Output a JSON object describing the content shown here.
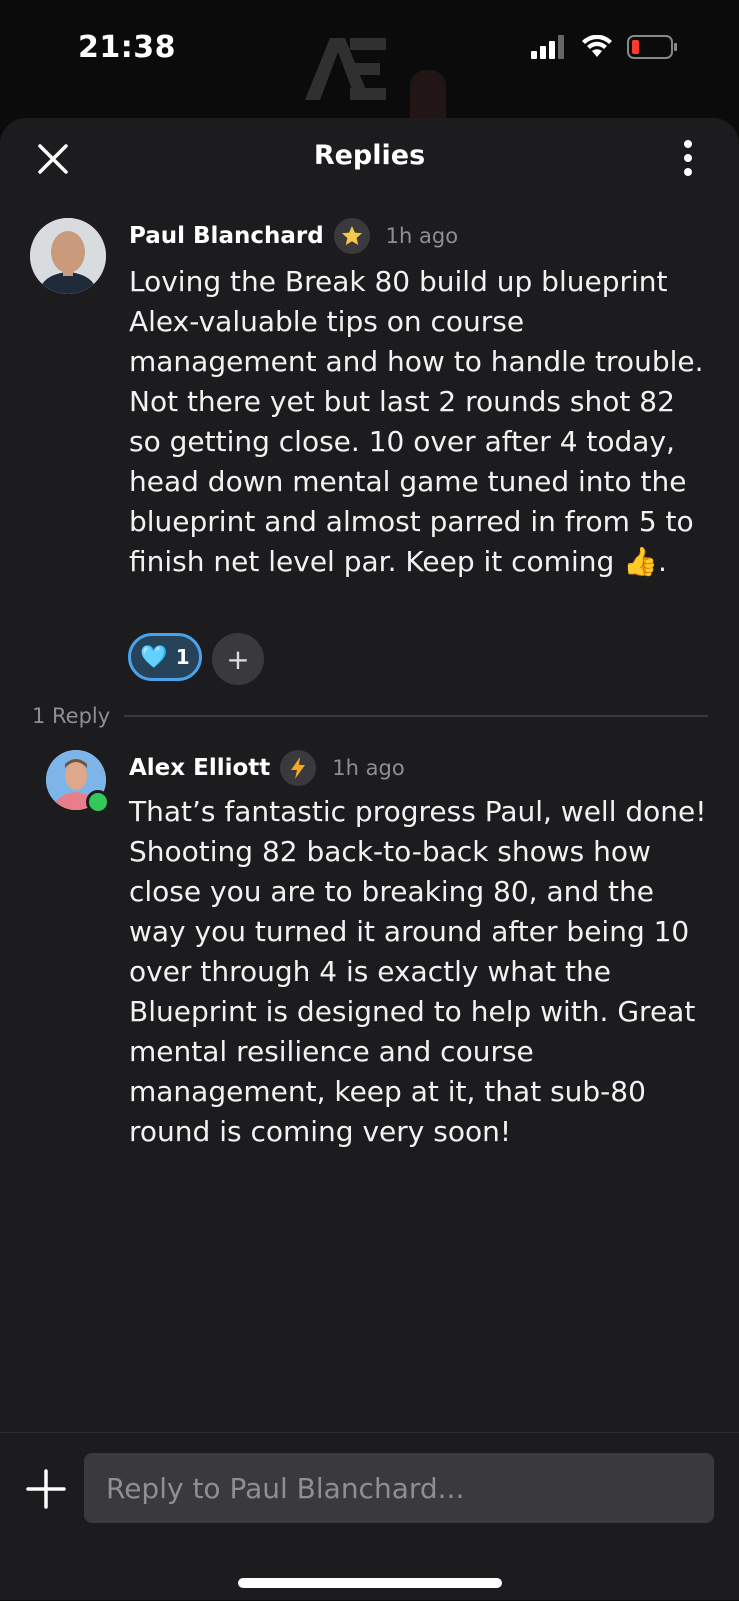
{
  "status_bar": {
    "time": "21:38"
  },
  "header": {
    "title": "Replies"
  },
  "post": {
    "author": "Paul Blanchard",
    "time_ago": "1h ago",
    "body": "Loving the Break 80 build up blueprint Alex-valuable tips on course management and how to handle trouble. Not there yet but last 2 rounds shot 82 so getting close. 10 over after 4 today, head down mental game tuned into the blueprint and almost parred in from 5 to finish net level par. Keep it coming 👍.",
    "reaction_emoji": "🩵",
    "reaction_count": "1",
    "add_reaction": "+"
  },
  "replies_divider": {
    "label": "1 Reply"
  },
  "reply": {
    "author": "Alex Elliott",
    "time_ago": "1h ago",
    "body": "That’s fantastic progress Paul, well done! Shooting 82 back-to-back shows how close you are to breaking 80, and the way you turned it around after being 10 over through 4 is exactly what the Blueprint is designed to help with. Great mental resilience and course management, keep at it, that sub-80 round is coming very soon!"
  },
  "composer": {
    "placeholder": "Reply to Paul Blanchard..."
  },
  "colors": {
    "sheet_bg": "#1c1c1e",
    "accent": "#4aa3e8",
    "online": "#34c759",
    "battery_low": "#ff3b30"
  }
}
